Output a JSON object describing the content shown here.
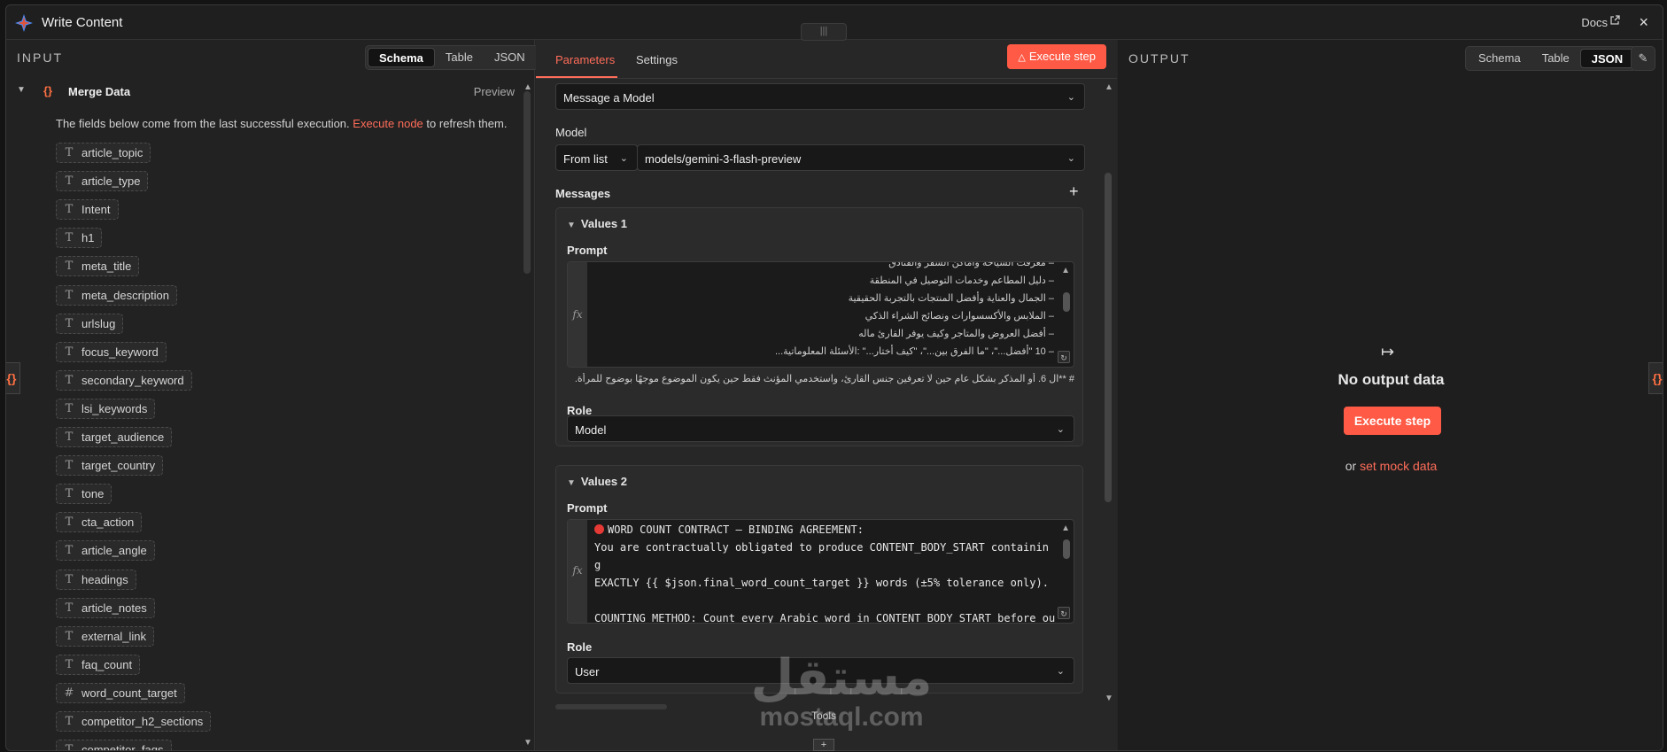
{
  "header": {
    "title": "Write Content",
    "docs_label": "Docs",
    "close_label": "×",
    "drag_label": "|||"
  },
  "input": {
    "panel_label": "INPUT",
    "view_tabs": [
      "Schema",
      "Table",
      "JSON"
    ],
    "active_tab": "Schema",
    "node_name": "Merge Data",
    "preview_label": "Preview",
    "info_prefix": "The fields below come from the last successful execution.",
    "info_link": "Execute node",
    "info_suffix": "to refresh them.",
    "fields": [
      {
        "type": "T",
        "name": "article_topic"
      },
      {
        "type": "T",
        "name": "article_type"
      },
      {
        "type": "T",
        "name": "Intent"
      },
      {
        "type": "T",
        "name": "h1"
      },
      {
        "type": "T",
        "name": "meta_title"
      },
      {
        "type": "T",
        "name": "meta_description"
      },
      {
        "type": "T",
        "name": "urlslug"
      },
      {
        "type": "T",
        "name": "focus_keyword"
      },
      {
        "type": "T",
        "name": "secondary_keyword"
      },
      {
        "type": "T",
        "name": "lsi_keywords"
      },
      {
        "type": "T",
        "name": "target_audience"
      },
      {
        "type": "T",
        "name": "target_country"
      },
      {
        "type": "T",
        "name": "tone"
      },
      {
        "type": "T",
        "name": "cta_action"
      },
      {
        "type": "T",
        "name": "article_angle"
      },
      {
        "type": "T",
        "name": "headings"
      },
      {
        "type": "T",
        "name": "article_notes"
      },
      {
        "type": "T",
        "name": "external_link"
      },
      {
        "type": "T",
        "name": "faq_count"
      },
      {
        "type": "#",
        "name": "word_count_target"
      },
      {
        "type": "T",
        "name": "competitor_h2_sections"
      },
      {
        "type": "T",
        "name": "competitor_faqs"
      }
    ]
  },
  "parameters": {
    "tabs": [
      "Parameters",
      "Settings"
    ],
    "execute_label": "Execute step",
    "operation": "Message a Model",
    "model_label": "Model",
    "model_mode": "From list",
    "model_value": "models/gemini-3-flash-preview",
    "messages_label": "Messages",
    "add_label": "+",
    "values": [
      {
        "title": "Values 1",
        "prompt_label": "Prompt",
        "fx": "fx",
        "lines": [
          "– معرفت السياحة وأماكن السفر والفنادق",
          "– دليل المطاعم وخدمات التوصيل في المنطقة",
          "– الجمال والعناية وأفضل المنتجات بالتجربة الحقيقية",
          "– الملابس والأكسسوارات ونصائح الشراء الذكي",
          "– أفضل العروض والمتاجر وكيف يوفر القارئ ماله",
          "– 10 \"أفضل...\"، \"ما الفرق بين...\"، \"كيف أختار...\" :الأسئلة المعلوماتية..."
        ],
        "overflow_line": "# **ال 6. أو المذكر بشكل عام حين لا تعرفين جنس القارئ، واستخدمي المؤنث فقط حين يكون الموضوع موجهًا بوضوح للمرأة.",
        "role_label": "Role",
        "role": "Model"
      },
      {
        "title": "Values 2",
        "prompt_label": "Prompt",
        "fx": "fx",
        "lines": [
          "WORD COUNT CONTRACT — BINDING AGREEMENT:",
          "You are contractually obligated to produce CONTENT_BODY_START containin",
          "g",
          "EXACTLY {{ $json.final_word_count_target }} words (±5% tolerance only).",
          "",
          "COUNTING METHOD: Count every Arabic word in CONTENT_BODY_START before ou"
        ],
        "role_label": "Role",
        "role": "User"
      }
    ],
    "tools_label": "Tools"
  },
  "output": {
    "panel_label": "OUTPUT",
    "view_tabs": [
      "Schema",
      "Table",
      "JSON"
    ],
    "active_tab": "JSON",
    "empty_title": "No output data",
    "execute_label": "Execute step",
    "mock_prefix": "or",
    "mock_link": "set mock data"
  },
  "watermark": {
    "arabic": "مستقل",
    "latin": "mostaql.com"
  },
  "colors": {
    "accent": "#ff6d5a",
    "button": "#ff5a45",
    "panel_bg": "#222222"
  }
}
